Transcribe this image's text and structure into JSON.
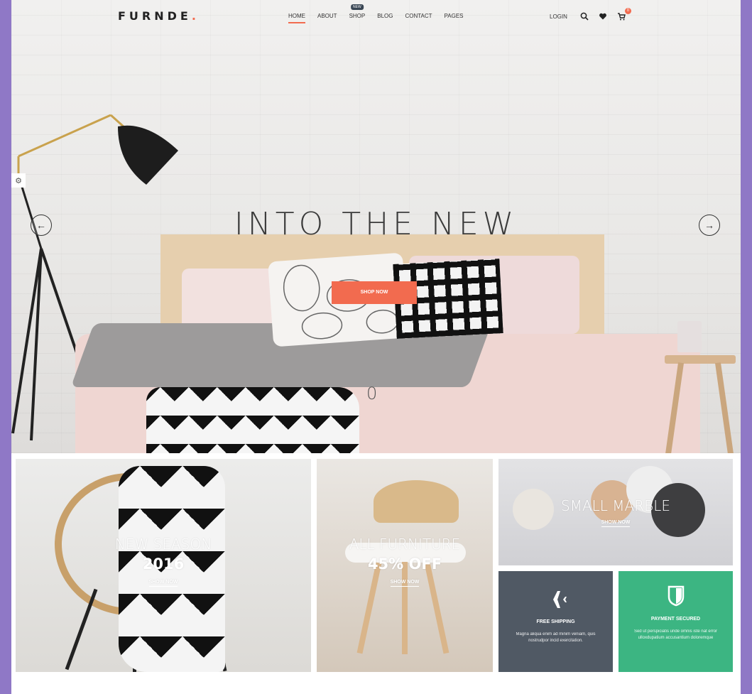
{
  "brand": {
    "name": "FURNDE",
    "dot": "."
  },
  "nav": {
    "items": [
      {
        "label": "HOME",
        "active": true
      },
      {
        "label": "ABOUT"
      },
      {
        "label": "SHOP",
        "badge": "NEW"
      },
      {
        "label": "BLOG"
      },
      {
        "label": "CONTACT"
      },
      {
        "label": "PAGES"
      }
    ]
  },
  "header": {
    "login_label": "LOGIN",
    "icons": [
      "search-icon",
      "heart-icon",
      "cart-icon"
    ],
    "cart_count": "0"
  },
  "hero": {
    "title": "INTO THE NEW",
    "button_label": "SHOP NOW",
    "slide_number": "0"
  },
  "banners": {
    "season": {
      "title": "NEW SEASON",
      "subtitle": "2016",
      "link": "SHOW NOW"
    },
    "furniture": {
      "title": "ALL FURNITURE",
      "subtitle": "45% OFF",
      "link": "SHOW NOW"
    },
    "marble": {
      "title": "SMALL MARBLE",
      "link": "SHOW NOW"
    }
  },
  "features": {
    "shipping": {
      "icon": "airplane-icon",
      "title": "FREE SHIPPING",
      "desc": "Magna aliqua enim ad minim veniam, quis nostrudpor incid exercitation."
    },
    "payment": {
      "icon": "shield-icon",
      "title": "PAYMENT SECURED",
      "desc": "Sed ut perspiciatis unde omnis iste nat error ulloxdupatium accusantium doloremque"
    }
  },
  "colors": {
    "accent": "#f26b4f",
    "frame": "#8f78c6",
    "shipping_bg": "#505964",
    "payment_bg": "#3cb582"
  }
}
